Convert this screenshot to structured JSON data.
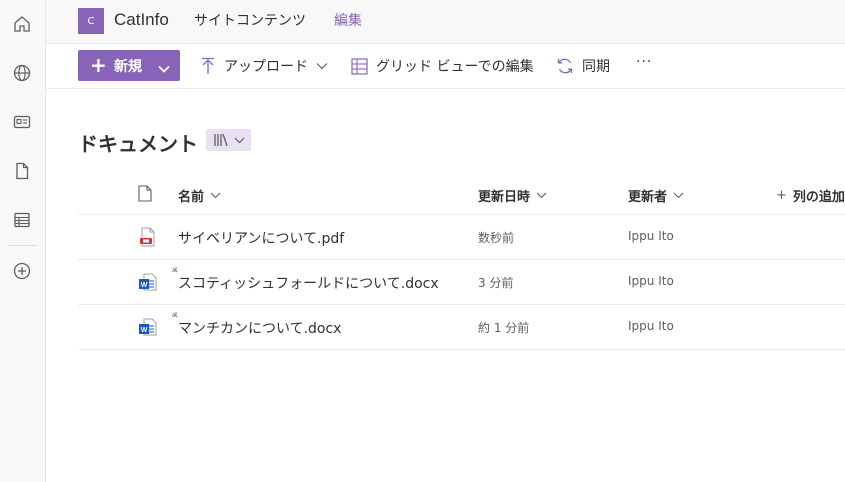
{
  "site": {
    "logo_letter": "C",
    "title": "CatInfo",
    "nav": {
      "site_contents": "サイトコンテンツ",
      "edit": "編集"
    }
  },
  "rail": {
    "icons": [
      "home-icon",
      "globe-icon",
      "news-icon",
      "document-icon",
      "list-icon",
      "add-circle-icon"
    ]
  },
  "commands": {
    "new_label": "新規",
    "upload_label": "アップロード",
    "grid_edit_label": "グリッド ビューでの編集",
    "sync_label": "同期",
    "more_label": "···"
  },
  "library": {
    "title": "ドキュメント",
    "columns": {
      "name": "名前",
      "modified": "更新日時",
      "modified_by": "更新者",
      "add_column": "列の追加"
    },
    "files": [
      {
        "name": "サイベリアンについて.pdf",
        "modified": "数秒前",
        "modified_by": "Ippu Ito",
        "type": "pdf-icon",
        "is_new": false
      },
      {
        "name": "スコティッシュフォールドについて.docx",
        "modified": "3 分前",
        "modified_by": "Ippu Ito",
        "type": "word-icon",
        "is_new": true
      },
      {
        "name": "マンチカンについて.docx",
        "modified": "約 1 分前",
        "modified_by": "Ippu Ito",
        "type": "word-icon",
        "is_new": true
      }
    ]
  },
  "colors": {
    "accent": "#8764b8",
    "word": "#185abd",
    "pdf": "#d13438"
  }
}
